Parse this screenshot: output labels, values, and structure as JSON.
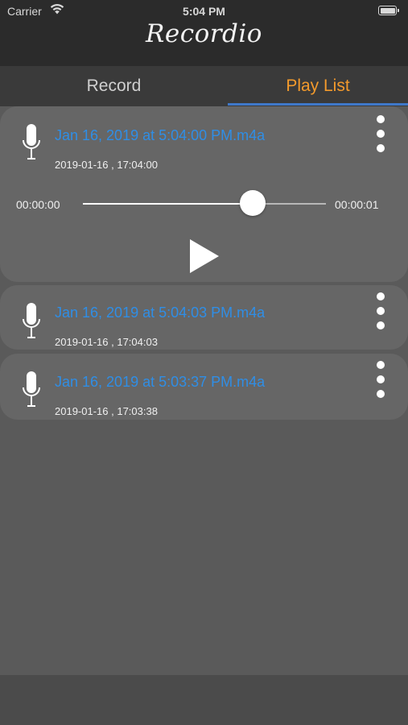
{
  "status": {
    "carrier": "Carrier",
    "time": "5:04 PM"
  },
  "app": {
    "title": "Recordio"
  },
  "tabs": [
    {
      "label": "Record",
      "active": false
    },
    {
      "label": "Play List",
      "active": true
    }
  ],
  "colors": {
    "accent_tab": "#f39a2c",
    "link": "#2f8ee6",
    "indicator": "#3f78c9"
  },
  "recordings": [
    {
      "name": "Jan 16, 2019 at 5:04:00 PM.m4a",
      "date": "2019-01-16 , 17:04:00",
      "expanded": true,
      "player": {
        "elapsed": "00:00:00",
        "duration": "00:00:01",
        "progress": 0.7
      }
    },
    {
      "name": "Jan 16, 2019 at 5:04:03 PM.m4a",
      "date": "2019-01-16 , 17:04:03",
      "expanded": false
    },
    {
      "name": "Jan 16, 2019 at 5:03:37 PM.m4a",
      "date": "2019-01-16 , 17:03:38",
      "expanded": false
    }
  ],
  "icons": {
    "mic": "microphone-icon",
    "more": "more-vertical-icon",
    "play": "play-icon",
    "wifi": "wifi-icon",
    "battery": "battery-icon"
  }
}
